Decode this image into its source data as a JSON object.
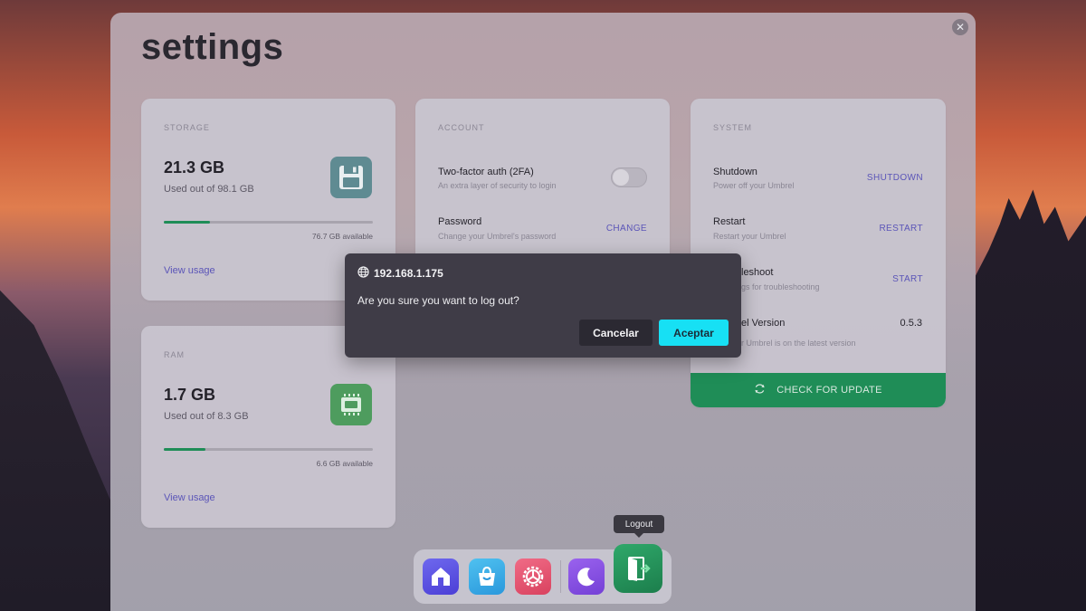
{
  "page": {
    "title": "settings"
  },
  "storage": {
    "heading": "STORAGE",
    "value": "21.3 GB",
    "used": "Used out of 98.1 GB",
    "available": "76.7 GB available",
    "usage_fraction": 0.22,
    "link": "View usage",
    "icon": "floppy-disk-icon"
  },
  "ram": {
    "heading": "RAM",
    "value": "1.7 GB",
    "used": "Used out of 8.3 GB",
    "available": "6.6 GB available",
    "usage_fraction": 0.2,
    "link": "View usage",
    "icon": "ram-chip-icon"
  },
  "account": {
    "heading": "ACCOUNT",
    "twofa": {
      "title": "Two-factor auth (2FA)",
      "subtitle": "An extra layer of security to login",
      "enabled": false
    },
    "password": {
      "title": "Password",
      "subtitle": "Change your Umbrel's password",
      "action": "CHANGE"
    }
  },
  "system": {
    "heading": "SYSTEM",
    "shutdown": {
      "title": "Shutdown",
      "subtitle": "Power off your Umbrel",
      "action": "SHUTDOWN"
    },
    "restart": {
      "title": "Restart",
      "subtitle": "Restart your Umbrel",
      "action": "RESTART"
    },
    "troubleshoot": {
      "title": "leshoot",
      "subtitle": "gs for troubleshooting",
      "action": "START"
    },
    "version": {
      "title": "el Version",
      "subtitle": "r Umbrel is on the latest version",
      "value": "0.5.3"
    },
    "update_button": "CHECK FOR UPDATE"
  },
  "dialog": {
    "host": "192.168.1.175",
    "message": "Are you sure you want to log out?",
    "cancel": "Cancelar",
    "accept": "Aceptar"
  },
  "dock": {
    "tooltip": "Logout",
    "apps": [
      "home-icon",
      "app-store-icon",
      "settings-icon",
      "moon-icon",
      "logout-icon"
    ]
  },
  "colors": {
    "accent_green": "#1f8d57",
    "link_purple": "#5b55b8",
    "dialog_accept": "#17e0f4"
  }
}
